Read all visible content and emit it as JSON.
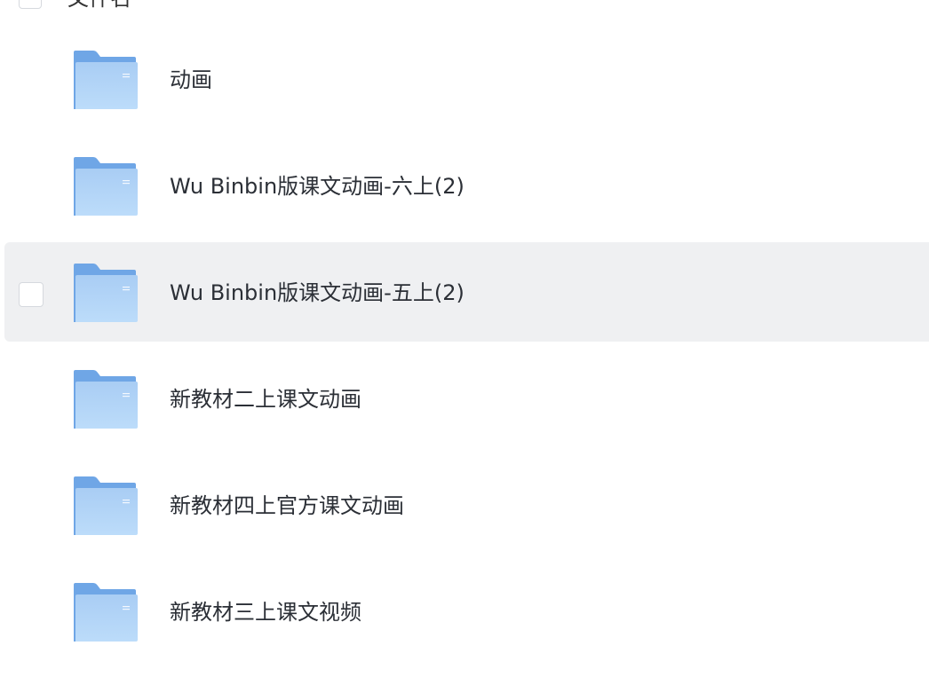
{
  "header": {
    "select_all_label": "文件名"
  },
  "files": [
    {
      "name": "动画",
      "type": "folder",
      "selected": false,
      "icon": "folder-icon"
    },
    {
      "name": "Wu Binbin版课文动画-六上(2)",
      "type": "folder",
      "selected": false,
      "icon": "folder-icon"
    },
    {
      "name": "Wu Binbin版课文动画-五上(2)",
      "type": "folder",
      "selected": true,
      "icon": "folder-icon"
    },
    {
      "name": "新教材二上课文动画",
      "type": "folder",
      "selected": false,
      "icon": "folder-icon"
    },
    {
      "name": "新教材四上官方课文动画",
      "type": "folder",
      "selected": false,
      "icon": "folder-icon"
    },
    {
      "name": "新教材三上课文视频",
      "type": "folder",
      "selected": false,
      "icon": "folder-icon"
    }
  ],
  "colors": {
    "selected_row_bg": "#eff0f2",
    "folder_back": "#6fa6e6",
    "folder_front_top": "#a9cdf4",
    "folder_front_bottom": "#bcdcfa",
    "text": "#2b2f36",
    "checkbox_border": "#d6d9de"
  }
}
